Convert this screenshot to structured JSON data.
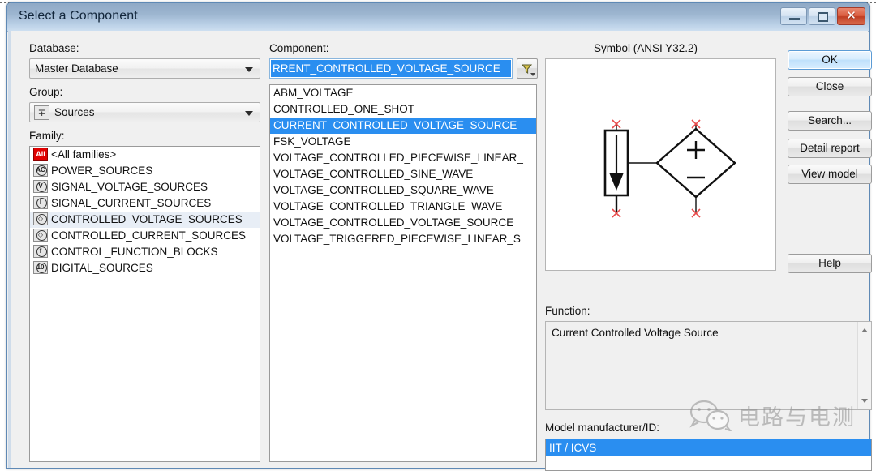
{
  "window": {
    "title": "Select a Component",
    "buttons": {
      "minimize": "minimize-button",
      "maximize": "maximize-button",
      "close": "close-button",
      "close_glyph": "✕"
    }
  },
  "left_panel": {
    "database_label": "Database:",
    "database_value": "Master Database",
    "group_label": "Group:",
    "group_value": "Sources",
    "group_icon": "∓",
    "family_label": "Family:",
    "families": [
      {
        "label": "<All families>",
        "icon": "all-families-icon",
        "glyph": "All",
        "selected": false,
        "all": true
      },
      {
        "label": "POWER_SOURCES",
        "icon": "power-sources-icon",
        "glyph": "AC",
        "selected": false
      },
      {
        "label": "SIGNAL_VOLTAGE_SOURCES",
        "icon": "signal-voltage-sources-icon",
        "glyph": "V",
        "selected": false
      },
      {
        "label": "SIGNAL_CURRENT_SOURCES",
        "icon": "signal-current-sources-icon",
        "glyph": "I",
        "selected": false
      },
      {
        "label": "CONTROLLED_VOLTAGE_SOURCES",
        "icon": "controlled-voltage-sources-icon",
        "glyph": "◇",
        "selected": true
      },
      {
        "label": "CONTROLLED_CURRENT_SOURCES",
        "icon": "controlled-current-sources-icon",
        "glyph": "◇",
        "selected": false
      },
      {
        "label": "CONTROL_FUNCTION_BLOCKS",
        "icon": "control-function-blocks-icon",
        "glyph": "f",
        "selected": false
      },
      {
        "label": "DIGITAL_SOURCES",
        "icon": "digital-sources-icon",
        "glyph": "10",
        "selected": false
      }
    ]
  },
  "component_panel": {
    "label": "Component:",
    "field_value": "RRENT_CONTROLLED_VOLTAGE_SOURCE",
    "filter_button": "filter-button",
    "items": [
      {
        "label": "ABM_VOLTAGE",
        "selected": false
      },
      {
        "label": "CONTROLLED_ONE_SHOT",
        "selected": false
      },
      {
        "label": "CURRENT_CONTROLLED_VOLTAGE_SOURCE",
        "selected": true
      },
      {
        "label": "FSK_VOLTAGE",
        "selected": false
      },
      {
        "label": "VOLTAGE_CONTROLLED_PIECEWISE_LINEAR_",
        "selected": false
      },
      {
        "label": "VOLTAGE_CONTROLLED_SINE_WAVE",
        "selected": false
      },
      {
        "label": "VOLTAGE_CONTROLLED_SQUARE_WAVE",
        "selected": false
      },
      {
        "label": "VOLTAGE_CONTROLLED_TRIANGLE_WAVE",
        "selected": false
      },
      {
        "label": "VOLTAGE_CONTROLLED_VOLTAGE_SOURCE",
        "selected": false
      },
      {
        "label": "VOLTAGE_TRIGGERED_PIECEWISE_LINEAR_S",
        "selected": false
      }
    ]
  },
  "symbol_panel": {
    "title": "Symbol (ANSI Y32.2)",
    "diagram": "current-controlled-voltage-source-symbol",
    "plus_sign": "+",
    "minus_sign": "−"
  },
  "function_panel": {
    "label": "Function:",
    "text": "Current Controlled Voltage Source"
  },
  "model_panel": {
    "label": "Model manufacturer/ID:",
    "value": "IIT / ICVS"
  },
  "action_buttons": [
    {
      "label": "OK",
      "name": "ok-button",
      "primary": true
    },
    {
      "label": "Close",
      "name": "close-dialog-button",
      "primary": false
    },
    {
      "label": "Search...",
      "name": "search-button",
      "primary": false
    },
    {
      "label": "Detail report",
      "name": "detail-report-button",
      "primary": false
    },
    {
      "label": "View model",
      "name": "view-model-button",
      "primary": false
    },
    {
      "label": "Help",
      "name": "help-button",
      "primary": false
    }
  ],
  "watermark": {
    "text": "电路与电测",
    "logo": "wechat-logo"
  },
  "colors": {
    "selection": "#2a8ef0",
    "title_bar": "#9db6d0",
    "close_button": "#bf3d22",
    "dialog_bg": "#f0f0f0",
    "pin_marker": "#e84a4a"
  }
}
